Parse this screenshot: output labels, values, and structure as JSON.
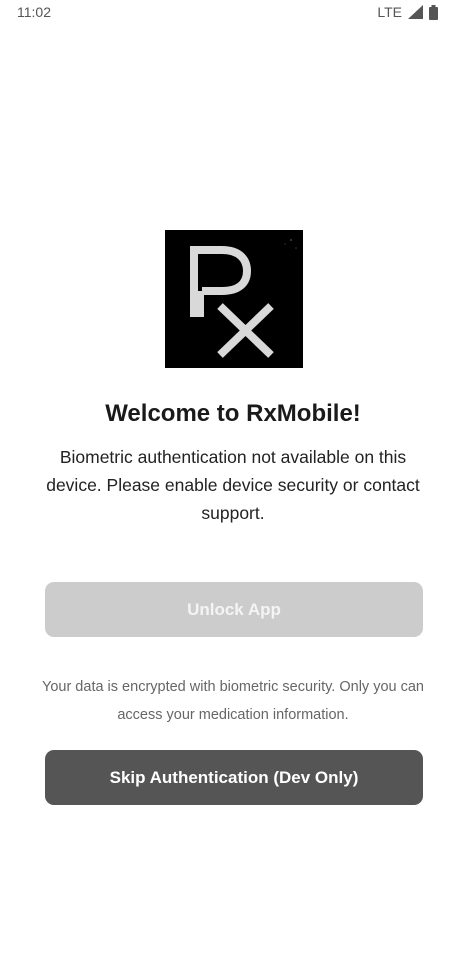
{
  "status_bar": {
    "time": "11:02",
    "network": "LTE",
    "signal_icon": "cell-signal-icon",
    "battery_icon": "battery-icon"
  },
  "logo": {
    "text": "Rx",
    "icon": "rx-logo-icon"
  },
  "welcome": {
    "title": "Welcome to RxMobile!",
    "message": "Biometric authentication not available on this device. Please enable device security or contact support."
  },
  "unlock_button": {
    "label": "Unlock App",
    "disabled": true,
    "color": "#cccccc"
  },
  "security_note": "Your data is encrypted with biometric security. Only you can access your medication information.",
  "skip_button": {
    "label": "Skip Authentication (Dev Only)",
    "color": "#555555"
  }
}
